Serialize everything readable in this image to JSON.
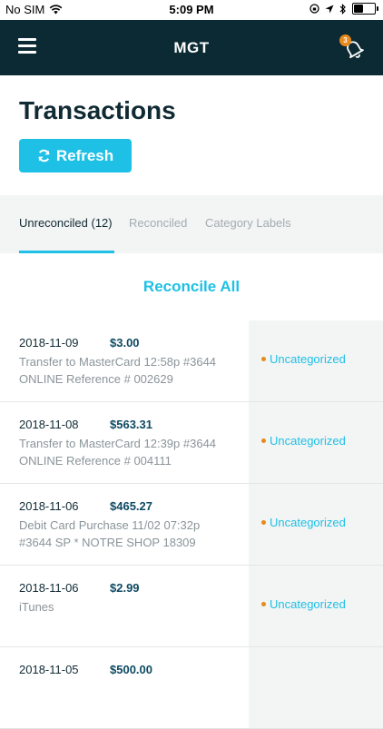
{
  "status_bar": {
    "carrier": "No SIM",
    "time": "5:09 PM",
    "battery_level": 0.45
  },
  "header": {
    "title": "MGT",
    "notification_count": "3"
  },
  "page": {
    "title": "Transactions",
    "refresh_label": "Refresh"
  },
  "tabs": [
    {
      "label": "Unreconciled (12)",
      "active": true
    },
    {
      "label": "Reconciled",
      "active": false
    },
    {
      "label": "Category Labels",
      "active": false
    }
  ],
  "reconcile_all_label": "Reconcile All",
  "transactions": [
    {
      "date": "2018-11-09",
      "amount": "$3.00",
      "desc1": "Transfer to MasterCard 12:58p #3644",
      "desc2": "ONLINE Reference # 002629",
      "category": "Uncategorized"
    },
    {
      "date": "2018-11-08",
      "amount": "$563.31",
      "desc1": "Transfer to MasterCard 12:39p #3644",
      "desc2": "ONLINE Reference # 004111",
      "category": "Uncategorized"
    },
    {
      "date": "2018-11-06",
      "amount": "$465.27",
      "desc1": "Debit Card Purchase 11/02 07:32p",
      "desc2": "#3644 SP * NOTRE SHOP 18309",
      "category": "Uncategorized"
    },
    {
      "date": "2018-11-06",
      "amount": "$2.99",
      "desc1": "iTunes",
      "desc2": "",
      "category": "Uncategorized"
    },
    {
      "date": "2018-11-05",
      "amount": "$500.00",
      "desc1": "",
      "desc2": "",
      "category": ""
    }
  ],
  "colors": {
    "header_bg": "#0b2a33",
    "accent": "#1ec0e6",
    "badge": "#e8891b",
    "title": "#102a34"
  },
  "icons": {
    "menu": "hamburger-icon",
    "notifications": "bell-icon",
    "refresh": "refresh-icon",
    "signal": "wifi-icon"
  }
}
